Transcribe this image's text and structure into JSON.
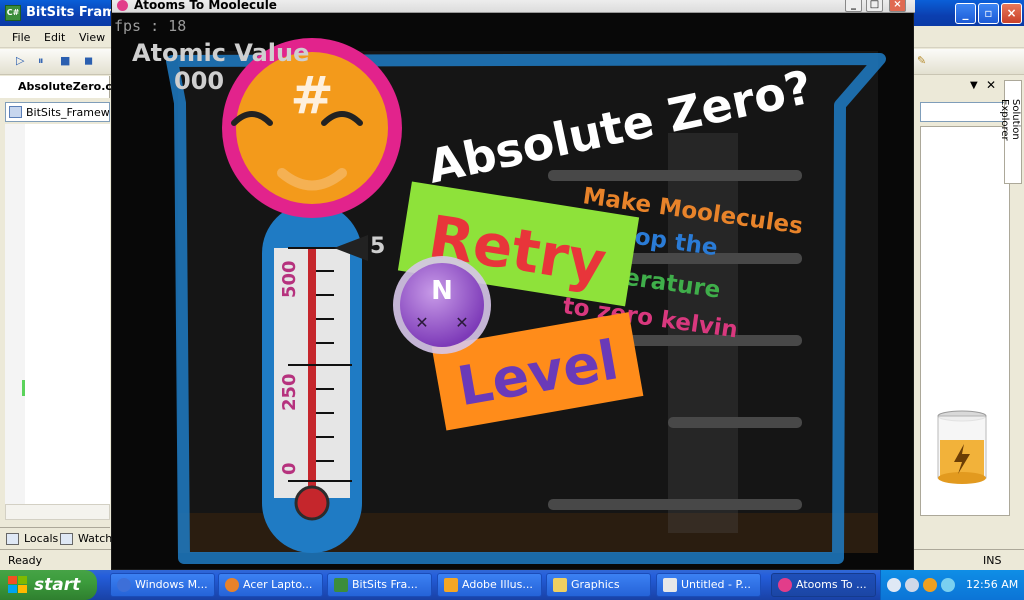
{
  "ide": {
    "title": "BitSits Frame",
    "menu": [
      "File",
      "Edit",
      "View"
    ],
    "doc_tab": "AbsoluteZero.cs",
    "project_dropdown": "BitSits_Framewor",
    "bottom_tabs": [
      "Locals",
      "Watch"
    ],
    "status_left": "Ready",
    "status_right": "INS",
    "solution_explorer": "Solution Explorer"
  },
  "game": {
    "window_title": "Atooms To Moolecule",
    "fps": "fps : 18",
    "atomic_value_label": "Atomic Value",
    "atomic_value": "000",
    "thermometer_ticks": [
      "500",
      "250",
      "0"
    ],
    "pointer_value": "5",
    "headline": "Absolute Zero?",
    "instructions": [
      "Make Moolecules",
      "to drop the",
      "temperature",
      "to zero kelvin"
    ],
    "retry_label": "Retry",
    "level_label": "Level",
    "atom_letter": "N",
    "face_symbol": "#",
    "colors": {
      "frame": "#1f7bc4",
      "retry_bg": "#8ee23a",
      "retry_text": "#e8353a",
      "level_bg": "#ff8c1a",
      "level_text": "#6a3ab8",
      "face": "#f39a1b",
      "face_ring": "#e2238c",
      "atom": "#9b59d0"
    }
  },
  "taskbar": {
    "start_label": "start",
    "tasks": [
      "Windows M...",
      "Acer Lapto...",
      "BitSits Fra...",
      "Adobe Illus...",
      "Graphics",
      "Untitled - P...",
      "Atooms To ..."
    ],
    "clock": "12:56 AM"
  }
}
